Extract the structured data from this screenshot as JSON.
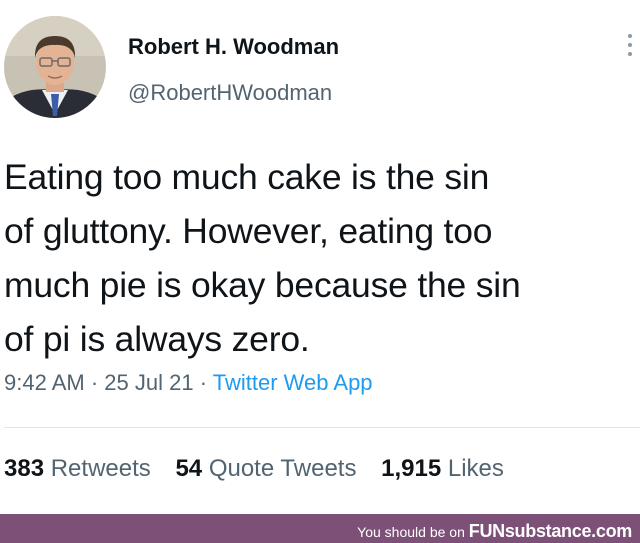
{
  "tweet": {
    "author": {
      "display_name": "Robert H. Woodman",
      "handle": "@RobertHWoodman",
      "avatar_icon": "profile-photo"
    },
    "text_lines": [
      "Eating too much cake is the sin",
      "of gluttony. However, eating too",
      "much pie is okay because the sin",
      "of pi is always zero."
    ],
    "time": "9:42 AM",
    "separator": "·",
    "date": "25 Jul 21",
    "source": "Twitter Web App",
    "stats": {
      "retweets_count": "383",
      "retweets_label": "Retweets",
      "quotes_count": "54",
      "quotes_label": "Quote Tweets",
      "likes_count": "1,915",
      "likes_label": "Likes"
    },
    "more_icon": "vertical-dots-icon"
  },
  "footer": {
    "prefix": "You should be on",
    "brand": "FUNsubstance.com"
  },
  "colors": {
    "text": "#0f1419",
    "secondary": "#536471",
    "link": "#1d9bf0",
    "footer_bg": "#7d5078"
  }
}
